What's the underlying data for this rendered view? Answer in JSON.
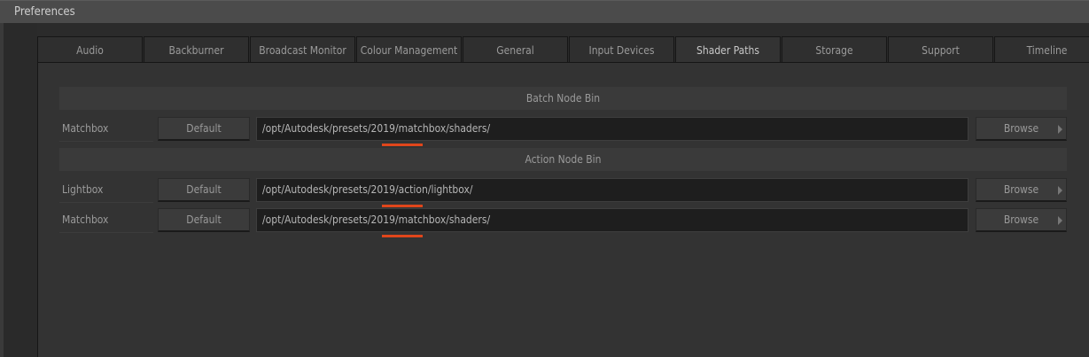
{
  "window": {
    "title": "Preferences"
  },
  "tabs": [
    "Audio",
    "Backburner",
    "Broadcast Monitor",
    "Colour Management",
    "General",
    "Input Devices",
    "Shader Paths",
    "Storage",
    "Support",
    "Timeline"
  ],
  "active_tab": "Shader Paths",
  "sections": [
    {
      "title": "Batch Node Bin",
      "rows": [
        {
          "label": "Matchbox",
          "default": "Default",
          "path": "/opt/Autodesk/presets/2019/matchbox/shaders/",
          "browse": "Browse"
        }
      ]
    },
    {
      "title": "Action Node Bin",
      "rows": [
        {
          "label": "Lightbox",
          "default": "Default",
          "path": "/opt/Autodesk/presets/2019/action/lightbox/",
          "browse": "Browse"
        },
        {
          "label": "Matchbox",
          "default": "Default",
          "path": "/opt/Autodesk/presets/2019/matchbox/shaders/",
          "browse": "Browse"
        }
      ]
    }
  ],
  "highlight_color": "#e0461b"
}
